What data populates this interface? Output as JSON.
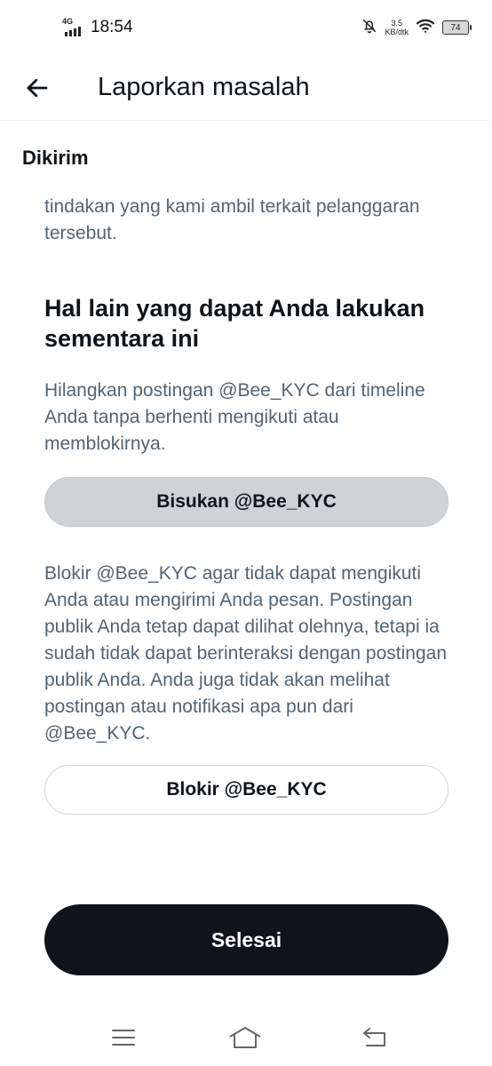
{
  "status_bar": {
    "network": "4G",
    "time": "18:54",
    "speed_value": "3.5",
    "speed_unit": "KB/dtk",
    "battery": "74"
  },
  "header": {
    "title": "Laporkan masalah",
    "back_icon": "arrow-left-icon"
  },
  "banner": {
    "label": "Dikirim"
  },
  "content": {
    "intro_text": "tindakan yang kami ambil terkait pelanggaran tersebut.",
    "heading": "Hal lain yang dapat Anda lakukan sementara ini",
    "mute_description": "Hilangkan postingan @Bee_KYC dari timeline Anda tanpa berhenti mengikuti atau memblokirnya.",
    "mute_button": "Bisukan @Bee_KYC",
    "block_description": "Blokir @Bee_KYC agar tidak dapat mengikuti Anda atau mengirimi Anda pesan. Postingan publik Anda tetap dapat dilihat olehnya, tetapi ia sudah tidak dapat berinteraksi dengan postingan publik Anda. Anda juga tidak akan melihat postingan atau notifikasi apa pun dari @Bee_KYC.",
    "block_button": "Blokir @Bee_KYC"
  },
  "footer": {
    "done_button": "Selesai"
  },
  "nav_bar": {
    "icons": [
      "menu-icon",
      "home-icon",
      "back-icon"
    ]
  },
  "colors": {
    "text_primary": "#0f1419",
    "text_secondary": "#536471",
    "mute_button_bg": "#cfd3d6",
    "done_button_bg": "#0f1419"
  }
}
